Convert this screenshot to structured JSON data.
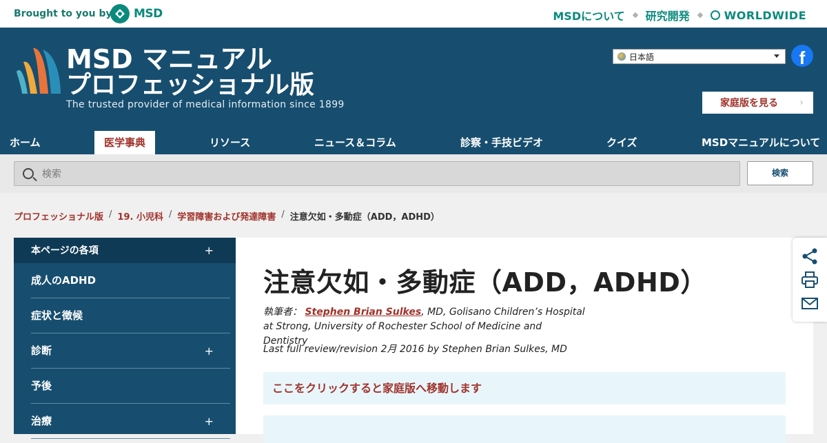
{
  "topbar": {
    "brought_by": "Brought to you by",
    "brand": "MSD",
    "links": [
      "MSDについて",
      "研究開発"
    ],
    "worldwide": "WORLDWIDE"
  },
  "header": {
    "title_line1": "MSD マニュアル",
    "title_line2": "プロフェッショナル版",
    "tagline": "The trusted provider of medical information since 1899",
    "language": "日本語",
    "facebook": "f",
    "consumer_button": "家庭版を見る",
    "consumer_button_chevron": "›"
  },
  "nav": {
    "items": [
      "ホーム",
      "医学事典",
      "リソース",
      "ニュース＆コラム",
      "診察・手技ビデオ",
      "クイズ",
      "MSDマニュアルについて"
    ],
    "active": "医学事典"
  },
  "search": {
    "placeholder": "検索",
    "button": "検索"
  },
  "breadcrumb": {
    "items": [
      "プロフェッショナル版",
      "19. 小児科",
      "学習障害および発達障害"
    ],
    "current": "注意欠如・多動症（ADD，ADHD）",
    "separator": "/"
  },
  "sidebar": {
    "header": "本ページの各項",
    "expand": "+",
    "items": [
      {
        "label": "成人のADHD",
        "expandable": false
      },
      {
        "label": "症状と徴候",
        "expandable": false
      },
      {
        "label": "診断",
        "expandable": true
      },
      {
        "label": "予後",
        "expandable": false
      },
      {
        "label": "治療",
        "expandable": true
      }
    ]
  },
  "main": {
    "title": "注意欠如・多動症（ADD，ADHD）",
    "author_prefix": "執筆者：",
    "author_name": "Stephen Brian Sulkes",
    "author_affiliation": ", MD, Golisano Children’s Hospital at Strong, University of Rochester School of Medicine and Dentistry",
    "review": "Last full review/revision 2月 2016 by Stephen Brian Sulkes, MD",
    "consumer_link": "ここをクリックすると家庭版へ移動します"
  },
  "share_tools": [
    "share-icon",
    "print-icon",
    "email-icon"
  ],
  "colors": {
    "header_bg": "#174e6f",
    "accent_red": "#a0322a",
    "msd_teal": "#0a8a7d"
  }
}
